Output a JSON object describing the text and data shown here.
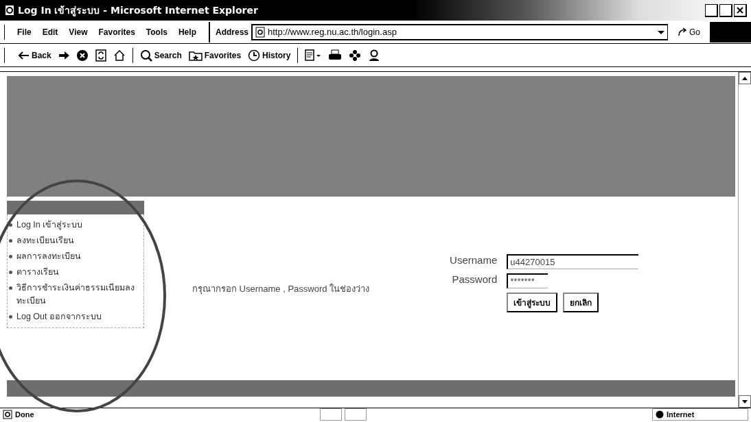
{
  "window": {
    "title": "Log In เข้าสู่ระบบ - Microsoft Internet Explorer"
  },
  "menu_bar": [
    "File",
    "Edit",
    "View",
    "Favorites",
    "Tools",
    "Help"
  ],
  "address_bar": {
    "label": "Address",
    "url": "http://www.reg.nu.ac.th/login.asp",
    "go": "Go"
  },
  "toolbar": [
    {
      "kind": "back",
      "label": "Back"
    },
    {
      "kind": "forward"
    },
    {
      "kind": "stop"
    },
    {
      "kind": "refresh"
    },
    {
      "kind": "home"
    },
    {
      "kind": "search",
      "label": "Search"
    },
    {
      "kind": "favorites",
      "label": "Favorites"
    },
    {
      "kind": "history",
      "label": "History"
    },
    {
      "kind": "mail"
    },
    {
      "kind": "print"
    },
    {
      "kind": "flower"
    },
    {
      "kind": "person"
    }
  ],
  "side_menu": {
    "items": [
      {
        "label": "Log In เข้าสู่ระบบ"
      },
      {
        "label": "ลงทะเบียนเรียน"
      },
      {
        "label": "ผลการลงทะเบียน"
      },
      {
        "label": "ตารางเรียน"
      },
      {
        "label": "วิธีการชำระเงินค่าธรรมเนียมลงทะเบียน"
      },
      {
        "label": "Log Out ออกจากระบบ"
      }
    ]
  },
  "message": "กรุณากรอก Username , Password ในช่องว่าง",
  "login_form": {
    "username_label": "Username",
    "username": "u44270015",
    "password_label": "Password",
    "password": "*******",
    "buttons": [
      "เข้าสู่ระบบ",
      "ยกเลิก"
    ]
  },
  "status_bar": {
    "text": "Done",
    "zone": "Internet"
  }
}
